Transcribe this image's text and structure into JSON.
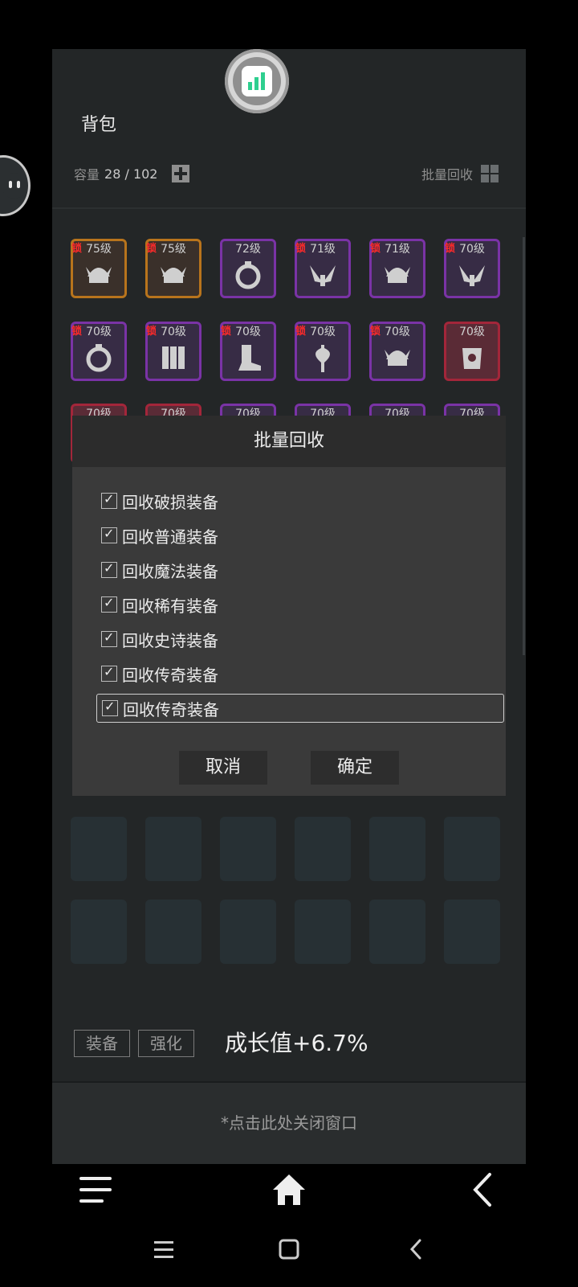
{
  "bag": {
    "title": "背包",
    "capacity_label": "容量",
    "capacity_value": "28 / 102",
    "batch_recycle_label": "批量回收"
  },
  "items": [
    {
      "level": "75级",
      "rarity": "orange",
      "locked": true,
      "lock_label": "锁",
      "icon": "helmet-icon"
    },
    {
      "level": "75级",
      "rarity": "orange",
      "locked": true,
      "lock_label": "锁",
      "icon": "helmet-icon"
    },
    {
      "level": "72级",
      "rarity": "purple",
      "locked": false,
      "lock_label": "",
      "icon": "ring-icon"
    },
    {
      "level": "71级",
      "rarity": "purple",
      "locked": true,
      "lock_label": "锁",
      "icon": "wings-icon"
    },
    {
      "level": "71级",
      "rarity": "purple",
      "locked": true,
      "lock_label": "锁",
      "icon": "helmet-icon"
    },
    {
      "level": "70级",
      "rarity": "purple",
      "locked": true,
      "lock_label": "锁",
      "icon": "wings-icon"
    },
    {
      "level": "70级",
      "rarity": "purple",
      "locked": true,
      "lock_label": "锁",
      "icon": "ring-icon"
    },
    {
      "level": "70级",
      "rarity": "purple",
      "locked": true,
      "lock_label": "锁",
      "icon": "armor-icon"
    },
    {
      "level": "70级",
      "rarity": "purple",
      "locked": true,
      "lock_label": "锁",
      "icon": "boots-icon"
    },
    {
      "level": "70级",
      "rarity": "purple",
      "locked": true,
      "lock_label": "锁",
      "icon": "axe-icon"
    },
    {
      "level": "70级",
      "rarity": "purple",
      "locked": true,
      "lock_label": "锁",
      "icon": "helmet-icon"
    },
    {
      "level": "70级",
      "rarity": "red",
      "locked": false,
      "lock_label": "",
      "icon": "chest-armor-icon"
    },
    {
      "level": "70级",
      "rarity": "red",
      "locked": false,
      "lock_label": "",
      "icon": "item-icon"
    },
    {
      "level": "70级",
      "rarity": "red",
      "locked": false,
      "lock_label": "",
      "icon": "item-icon"
    },
    {
      "level": "70级",
      "rarity": "purple",
      "locked": false,
      "lock_label": "",
      "icon": "item-icon"
    },
    {
      "level": "70级",
      "rarity": "purple",
      "locked": false,
      "lock_label": "",
      "icon": "item-icon"
    },
    {
      "level": "70级",
      "rarity": "purple",
      "locked": false,
      "lock_label": "",
      "icon": "item-icon"
    },
    {
      "level": "70级",
      "rarity": "purple",
      "locked": false,
      "lock_label": "",
      "icon": "item-icon"
    }
  ],
  "dialog": {
    "title": "批量回收",
    "options": [
      {
        "label": "回收破损装备",
        "checked": true
      },
      {
        "label": "回收普通装备",
        "checked": true
      },
      {
        "label": "回收魔法装备",
        "checked": true
      },
      {
        "label": "回收稀有装备",
        "checked": true
      },
      {
        "label": "回收史诗装备",
        "checked": true
      },
      {
        "label": "回收传奇装备",
        "checked": true
      },
      {
        "label": "回收传奇装备",
        "checked": true
      }
    ],
    "cancel": "取消",
    "confirm": "确定"
  },
  "bottom": {
    "tab_equip": "装备",
    "tab_enhance": "强化",
    "growth": "成长值+6.7%",
    "close_hint": "*点击此处关闭窗口"
  },
  "colors": {
    "orange": "#b8741c",
    "purple": "#7a33a6",
    "red": "#a3263a",
    "accent_green": "#2ecf8f"
  }
}
